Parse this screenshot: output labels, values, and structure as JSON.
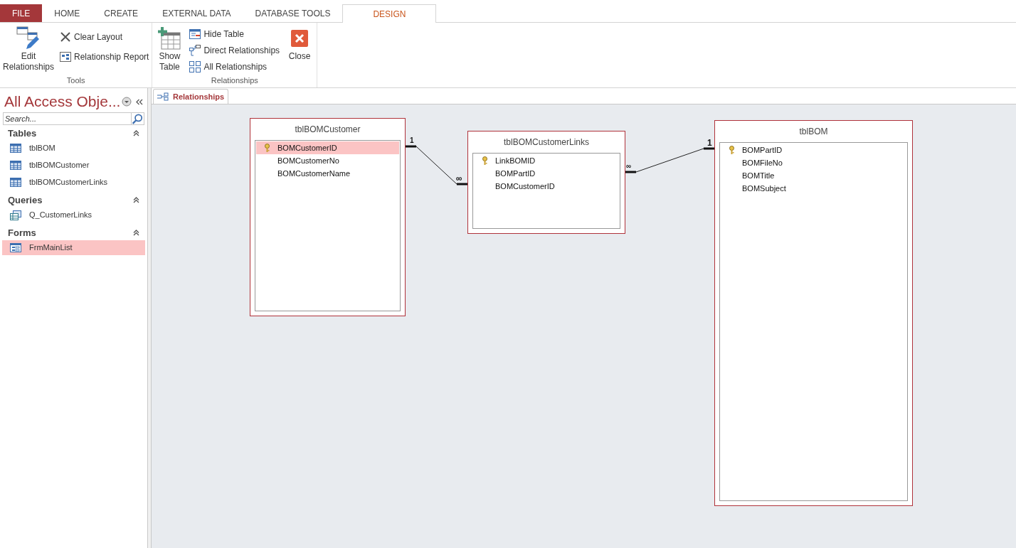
{
  "ribbon_tabs": [
    {
      "label": "FILE",
      "kind": "file"
    },
    {
      "label": "HOME",
      "kind": "tab",
      "selected": false
    },
    {
      "label": "CREATE",
      "kind": "tab",
      "selected": false
    },
    {
      "label": "EXTERNAL DATA",
      "kind": "tab",
      "selected": false
    },
    {
      "label": "DATABASE TOOLS",
      "kind": "tab",
      "selected": false
    },
    {
      "label": "DESIGN",
      "kind": "tab",
      "selected": true
    }
  ],
  "ribbon_groups": [
    {
      "label": "Tools",
      "commands": [
        {
          "label": "Edit Relationships",
          "kind": "large"
        },
        {
          "label": "Clear Layout",
          "kind": "small"
        },
        {
          "label": "Relationship Report",
          "kind": "small"
        }
      ]
    },
    {
      "label": "Relationships",
      "commands": [
        {
          "label": "Show Table",
          "kind": "large"
        },
        {
          "label": "Hide Table",
          "kind": "small"
        },
        {
          "label": "Direct Relationships",
          "kind": "small"
        },
        {
          "label": "All Relationships",
          "kind": "small"
        },
        {
          "label": "Close",
          "kind": "large"
        }
      ]
    }
  ],
  "navigation": {
    "title": "All Access Obje...",
    "search": {
      "placeholder": "Search..."
    },
    "groups": [
      {
        "label": "Tables",
        "kind": "table",
        "expanded": true,
        "items": [
          {
            "label": "tblBOM",
            "selected": false
          },
          {
            "label": "tblBOMCustomer",
            "selected": false
          },
          {
            "label": "tblBOMCustomerLinks",
            "selected": false
          }
        ]
      },
      {
        "label": "Queries",
        "kind": "query",
        "expanded": true,
        "items": [
          {
            "label": "Q_CustomerLinks",
            "selected": false
          }
        ]
      },
      {
        "label": "Forms",
        "kind": "form",
        "expanded": true,
        "items": [
          {
            "label": "FrmMainList",
            "selected": true
          }
        ]
      }
    ]
  },
  "document_tabs": [
    {
      "label": "Relationships",
      "selected": true
    }
  ],
  "diagram": {
    "tables": [
      {
        "name": "tblBOMCustomer",
        "fields": [
          {
            "name": "BOMCustomerID",
            "key": true,
            "selected": true
          },
          {
            "name": "BOMCustomerNo",
            "key": false,
            "selected": false
          },
          {
            "name": "BOMCustomerName",
            "key": false,
            "selected": false
          }
        ]
      },
      {
        "name": "tblBOMCustomerLinks",
        "fields": [
          {
            "name": "LinkBOMID",
            "key": true,
            "selected": false
          },
          {
            "name": "BOMPartID",
            "key": false,
            "selected": false
          },
          {
            "name": "BOMCustomerID",
            "key": false,
            "selected": false
          }
        ]
      },
      {
        "name": "tblBOM",
        "fields": [
          {
            "name": "BOMPartID",
            "key": true,
            "selected": false
          },
          {
            "name": "BOMFileNo",
            "key": false,
            "selected": false
          },
          {
            "name": "BOMTitle",
            "key": false,
            "selected": false
          },
          {
            "name": "BOMSubject",
            "key": false,
            "selected": false
          }
        ]
      }
    ],
    "relationships": [
      {
        "from_label": "1",
        "to_label": "∞"
      },
      {
        "from_label": "∞",
        "to_label": "1"
      }
    ]
  }
}
